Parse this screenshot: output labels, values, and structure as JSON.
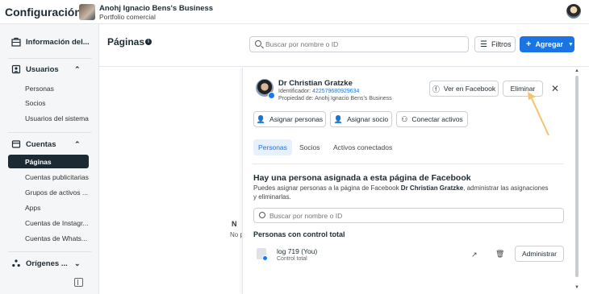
{
  "topbar": {
    "title": "Configuración",
    "business_name": "Anohj Ignacio Bens's Business",
    "business_sub": "Portfolio comercial"
  },
  "sidebar": {
    "business_info": "Información del...",
    "users_section": "Usuarios",
    "users_items": [
      "Personas",
      "Socios",
      "Usuarios del sistema"
    ],
    "accounts_section": "Cuentas",
    "accounts_items": [
      "Páginas",
      "Cuentas publicitarias",
      "Grupos de activos ...",
      "Apps",
      "Cuentas de Instagr...",
      "Cuentas de Whats..."
    ],
    "origins_section": "Orígenes ..."
  },
  "header": {
    "title": "Páginas",
    "search_placeholder": "Buscar por nombre o ID",
    "filters_label": "Filtros",
    "add_label": "Agregar"
  },
  "empty_fragment": {
    "line1": "N",
    "line2": "No p"
  },
  "panel": {
    "page_name": "Dr Christian Gratzke",
    "id_label": "Identificador:",
    "id_value": "422579680929634",
    "owner": "Propiedad de: Anohj Ignacio Bens's Business",
    "view_fb": "Ver en Facebook",
    "delete": "Eliminar",
    "assign_people": "Asignar personas",
    "assign_partner": "Asignar socio",
    "connect_assets": "Conectar activos",
    "tabs": [
      "Personas",
      "Socios",
      "Activos conectados"
    ],
    "assign_title": "Hay una persona asignada a esta página de Facebook",
    "assign_desc_pre": "Puedes asignar personas a la página de Facebook ",
    "assign_desc_name": "Dr Christian Gratzke",
    "assign_desc_post": ", administrar las asignaciones y eliminarlas.",
    "search_placeholder": "Buscar por nombre o ID",
    "section_label": "Personas con control total",
    "person_name": "log 719 (You)",
    "person_role": "Control total",
    "manage": "Administrar"
  },
  "colors": {
    "accent": "#1b74e4",
    "annotation": "#f2c46d",
    "active_nav": "#1c2b33"
  }
}
